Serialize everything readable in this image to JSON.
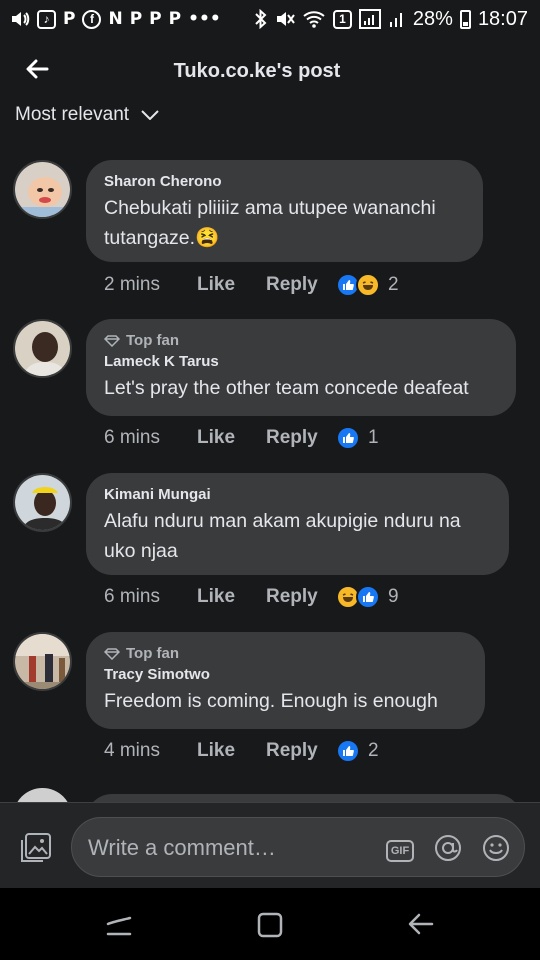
{
  "status_bar": {
    "left_icons": [
      "volume-icon",
      "tiktok-icon",
      "p-icon",
      "facebook-icon",
      "n-icon",
      "p-icon",
      "p-icon",
      "p-icon",
      "more-icon"
    ],
    "battery": "28%",
    "time": "18:07",
    "sim_label": "1"
  },
  "header": {
    "title": "Tuko.co.ke's post"
  },
  "sort": {
    "label": "Most relevant"
  },
  "comments": [
    {
      "author": "Sharon Cherono",
      "top_fan": false,
      "text": "Chebukati pliiiiz ama utupee wananchi tutangaze.😫",
      "time": "2 mins",
      "like": "Like",
      "reply": "Reply",
      "reactions": [
        "like",
        "haha"
      ],
      "count": "2"
    },
    {
      "author": "Lameck K Tarus",
      "top_fan": true,
      "top_fan_label": "Top fan",
      "text": "Let's pray the other team concede deafeat",
      "time": "6 mins",
      "like": "Like",
      "reply": "Reply",
      "reactions": [
        "like"
      ],
      "count": "1"
    },
    {
      "author": "Kimani Mungai",
      "top_fan": false,
      "text": "Alafu nduru man akam akupigie nduru na uko njaa",
      "time": "6 mins",
      "like": "Like",
      "reply": "Reply",
      "reactions": [
        "haha",
        "like"
      ],
      "count": "9"
    },
    {
      "author": "Tracy Simotwo",
      "top_fan": true,
      "top_fan_label": "Top fan",
      "text": "Freedom is coming. Enough is enough",
      "time": "4 mins",
      "like": "Like",
      "reply": "Reply",
      "reactions": [
        "like"
      ],
      "count": "2"
    }
  ],
  "composer": {
    "placeholder": "Write a comment…",
    "gif_label": "GIF"
  },
  "colors": {
    "background": "#18191a",
    "bubble": "#3a3b3c",
    "like_blue": "#1877f2",
    "haha_yellow": "#f7b928"
  }
}
